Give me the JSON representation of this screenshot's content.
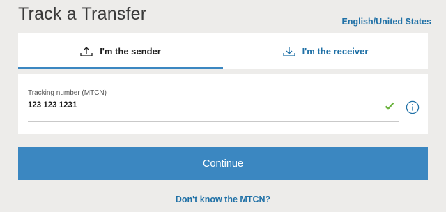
{
  "header": {
    "title": "Track a Transfer",
    "locale_link": "English/United States"
  },
  "tabs": [
    {
      "label": "I'm the sender",
      "icon": "upload-icon",
      "active": true
    },
    {
      "label": "I'm the receiver",
      "icon": "download-icon",
      "active": false
    }
  ],
  "form": {
    "tracking_label": "Tracking number (MTCN)",
    "tracking_value": "123 123 1231",
    "valid_icon": "checkmark-icon",
    "info_icon": "info-icon"
  },
  "actions": {
    "continue_label": "Continue",
    "help_link": "Don't know the MTCN?"
  },
  "colors": {
    "accent": "#3b87c1",
    "link": "#1f70a6",
    "valid": "#6cb33f",
    "background": "#edecea"
  }
}
